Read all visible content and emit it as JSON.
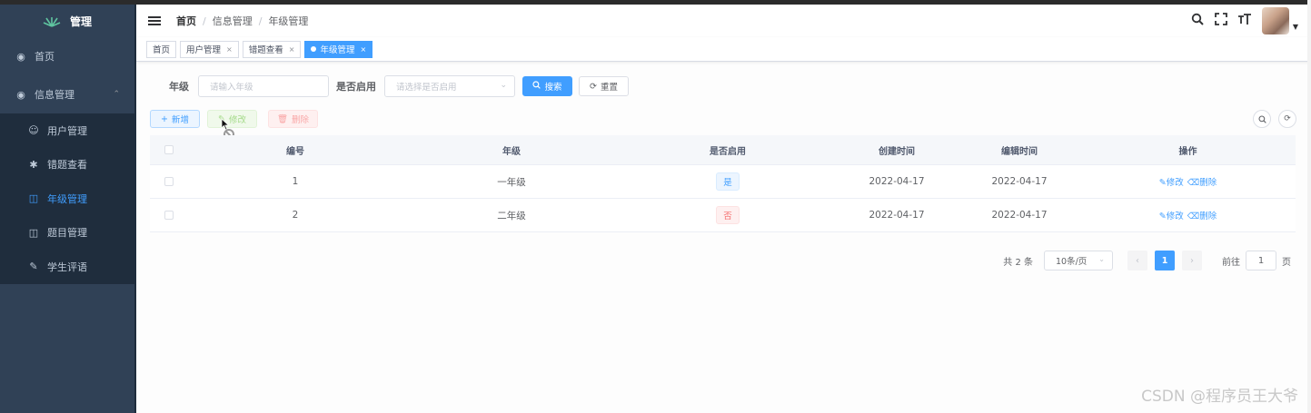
{
  "sidebar": {
    "logo_text": "管理",
    "items": [
      {
        "label": "首页",
        "icon": "dashboard-icon"
      },
      {
        "label": "信息管理",
        "icon": "dashboard-icon"
      }
    ],
    "submenu": [
      {
        "label": "用户管理",
        "icon": "user-icon"
      },
      {
        "label": "错题查看",
        "icon": "bug-icon"
      },
      {
        "label": "年级管理",
        "icon": "book-icon"
      },
      {
        "label": "题目管理",
        "icon": "book-icon"
      },
      {
        "label": "学生评语",
        "icon": "edit-icon"
      }
    ]
  },
  "navbar": {
    "breadcrumb": [
      "首页",
      "信息管理",
      "年级管理"
    ],
    "icons": [
      "search-icon",
      "fullscreen-icon",
      "font-size-icon"
    ]
  },
  "tags": [
    {
      "label": "首页"
    },
    {
      "label": "用户管理",
      "close": "×"
    },
    {
      "label": "错题查看",
      "close": "×"
    },
    {
      "label": "年级管理",
      "close": "×"
    }
  ],
  "filter": {
    "grade_label": "年级",
    "grade_placeholder": "请输入年级",
    "enabled_label": "是否启用",
    "enabled_placeholder": "请选择是否启用",
    "search": "搜索",
    "reset": "重置"
  },
  "toolbar": {
    "add": "新增",
    "edit": "修改",
    "delete": "删除"
  },
  "table": {
    "headers": [
      "编号",
      "年级",
      "是否启用",
      "创建时间",
      "编辑时间",
      "操作"
    ],
    "rows": [
      {
        "id": "1",
        "grade": "一年级",
        "enabled": "是",
        "created": "2022-04-17",
        "updated": "2022-04-17",
        "edit": "修改",
        "delete": "删除"
      },
      {
        "id": "2",
        "grade": "二年级",
        "enabled": "否",
        "created": "2022-04-17",
        "updated": "2022-04-17",
        "edit": "修改",
        "delete": "删除"
      }
    ]
  },
  "pagination": {
    "total": "共 2 条",
    "page_size": "10条/页",
    "current": "1",
    "goto_prefix": "前往",
    "goto_value": "1",
    "goto_suffix": "页"
  },
  "watermark": "CSDN @程序员王大爷",
  "colors": {
    "primary": "#409eff",
    "sidebar": "#304156",
    "danger": "#f56c6c"
  }
}
